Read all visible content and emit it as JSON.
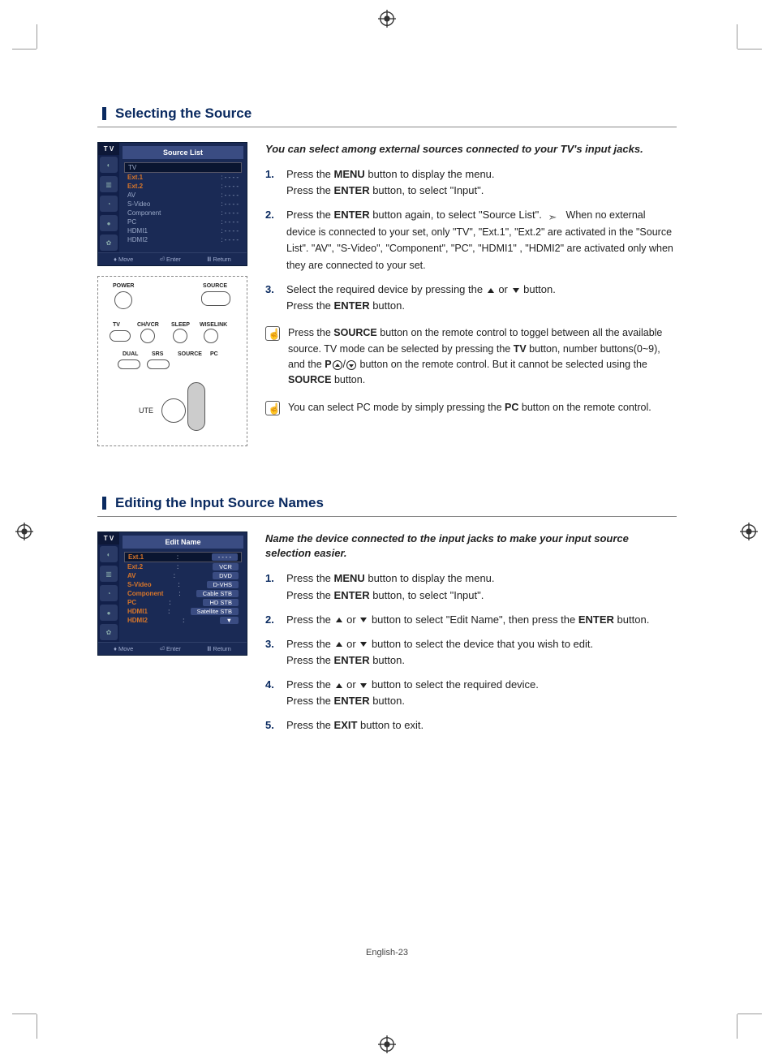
{
  "page_footer": "English-23",
  "section1": {
    "title": "Selecting the Source",
    "intro": "You can select among external sources connected to your TV's input jacks.",
    "steps": [
      {
        "parts": [
          "Press the ",
          "MENU",
          " button to display the menu."
        ],
        "sub": [
          "Press the ",
          "ENTER",
          " button, to select \"Input\"."
        ]
      },
      {
        "parts": [
          "Press the ",
          "ENTER",
          " button again, to select \"Source List\"."
        ],
        "note": "When no external device is connected to your set, only \"TV\", \"Ext.1\", \"Ext.2\" are activated in the \"Source List\". \"AV\", \"S-Video\", \"Component\", \"PC\", \"HDMI1\" , \"HDMI2\" are activated only when they are connected to your set."
      },
      {
        "pre": "Select the required device by pressing the ",
        "mid": " or ",
        "post": " button.",
        "sub": [
          "Press the ",
          "ENTER",
          " button."
        ]
      }
    ],
    "tips": [
      {
        "t1": "Press the ",
        "b1": "SOURCE",
        "t2": " button on the remote control to toggel between all the available source. TV mode can be selected by pressing the ",
        "b2": "TV",
        "t3": " button, number buttons(0~9), and the ",
        "b3": "P",
        "t4": " button on the remote control. But it cannot be selected using the ",
        "b4": "SOURCE",
        "t5": " button."
      },
      {
        "t1": "You can select PC mode by simply pressing the  ",
        "b1": "PC",
        "t2": " button on the remote control."
      }
    ],
    "osd": {
      "tab": "T V",
      "title": "Source List",
      "rows": [
        {
          "label": "TV",
          "val": "",
          "sel": true
        },
        {
          "label": "Ext.1",
          "val": ": - - - -",
          "act": true
        },
        {
          "label": "Ext.2",
          "val": ": - - - -",
          "act": true
        },
        {
          "label": "AV",
          "val": ": - - - -"
        },
        {
          "label": "S-Video",
          "val": ": - - - -"
        },
        {
          "label": "Component",
          "val": ": - - - -"
        },
        {
          "label": "PC",
          "val": ": - - - -"
        },
        {
          "label": "HDMI1",
          "val": ": - - - -"
        },
        {
          "label": "HDMI2",
          "val": ": - - - -"
        }
      ],
      "foot": [
        "Move",
        "Enter",
        "Return"
      ]
    },
    "remote": {
      "labels": [
        "POWER",
        "SOURCE",
        "TV",
        "CH/VCR",
        "SLEEP",
        "WISELINK",
        "DUAL",
        "SRS",
        "SOURCE",
        "PC"
      ]
    }
  },
  "section2": {
    "title": "Editing the Input Source Names",
    "intro": "Name the device connected to the input jacks to make your input source selection easier.",
    "steps": [
      {
        "parts": [
          "Press the ",
          "MENU",
          " button to display the menu."
        ],
        "sub": [
          "Press the ",
          "ENTER",
          " button, to select \"Input\"."
        ]
      },
      {
        "pre": "Press the ",
        "mid": " or ",
        "parts2": [
          " button to select \"Edit Name\", then press the ",
          "ENTER",
          " button."
        ]
      },
      {
        "pre": "Press the ",
        "mid": " or ",
        "post": " button to select the device that you wish to edit.",
        "sub": [
          "Press the ",
          "ENTER",
          "  button."
        ]
      },
      {
        "pre": "Press the ",
        "mid": " or ",
        "post": " button to select the required device.",
        "sub": [
          "Press the ",
          "ENTER",
          " button."
        ]
      },
      {
        "parts": [
          "Press the ",
          "EXIT",
          " button to exit."
        ]
      }
    ],
    "osd": {
      "tab": "T V",
      "title": "Edit Name",
      "rows": [
        {
          "label": "Ext.1",
          "pill": "- - - -",
          "sel": true,
          "act": true
        },
        {
          "label": "Ext.2",
          "pill": "VCR",
          "act": true
        },
        {
          "label": "AV",
          "pill": "DVD",
          "act": true
        },
        {
          "label": "S-Video",
          "pill": "D-VHS",
          "act": true
        },
        {
          "label": "Component",
          "pill": "Cable STB",
          "act": true
        },
        {
          "label": "PC",
          "pill": "HD STB",
          "act": true
        },
        {
          "label": "HDMI1",
          "pill": "Satellite STB",
          "act": true
        },
        {
          "label": "HDMI2",
          "pill": "▼",
          "act": true
        }
      ],
      "foot": [
        "Move",
        "Enter",
        "Return"
      ]
    }
  }
}
